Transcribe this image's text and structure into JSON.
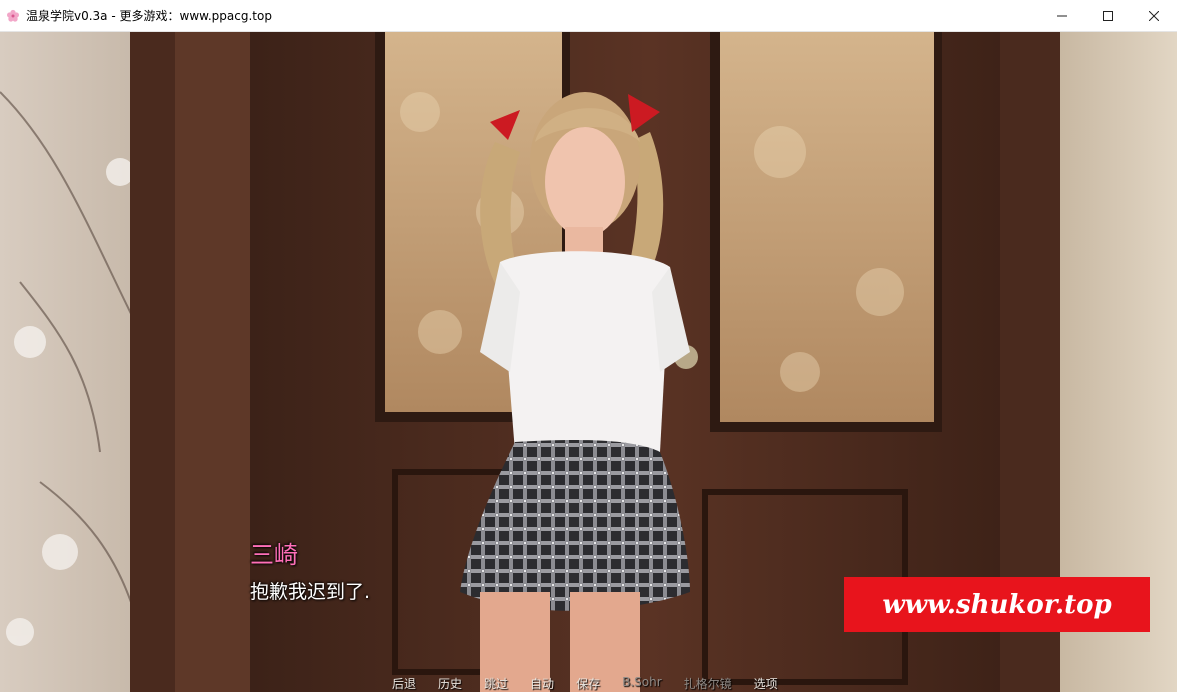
{
  "window": {
    "title": "温泉学院v0.3a - 更多游戏：www.ppacg.top",
    "minimize_icon": "minimize-icon",
    "maximize_icon": "maximize-icon",
    "close_icon": "close-icon"
  },
  "dialogue": {
    "speaker": "三崎",
    "text": "抱歉我迟到了.",
    "speaker_color": "#ff6fb8"
  },
  "quick_menu": [
    {
      "label": "后退"
    },
    {
      "label": "历史"
    },
    {
      "label": "跳过"
    },
    {
      "label": "自动"
    },
    {
      "label": "保存"
    },
    {
      "label": "B.Sohr"
    },
    {
      "label": "扎格尔镜"
    },
    {
      "label": "选项"
    }
  ],
  "watermark": {
    "text": "www.shukor.top",
    "background": "#e8141c"
  }
}
